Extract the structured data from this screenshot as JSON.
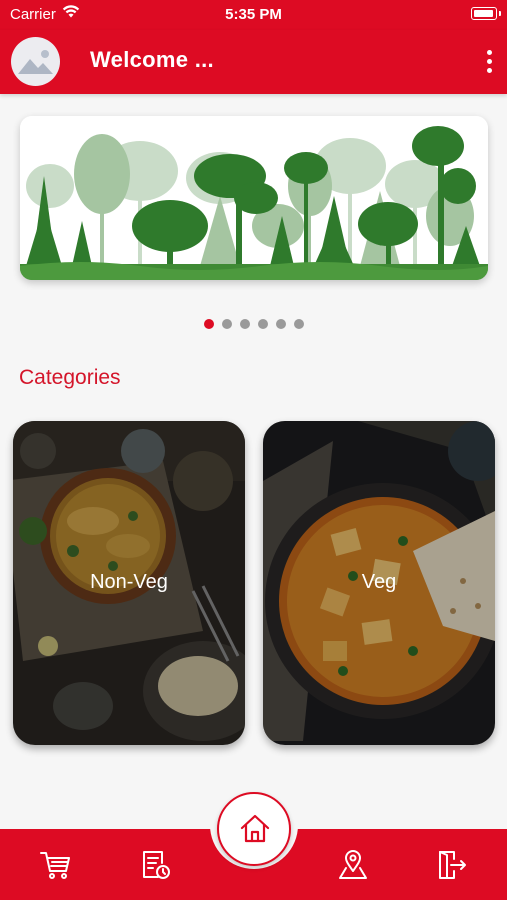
{
  "status_bar": {
    "carrier": "Carrier",
    "time": "5:35 PM"
  },
  "header": {
    "title": "Welcome ...",
    "avatar_icon": "image-placeholder-icon",
    "menu_icon": "more-vertical-icon"
  },
  "banner": {
    "image": "forest-trees-illustration",
    "slide_count": 6,
    "active_slide": 1
  },
  "categories": {
    "title": "Categories",
    "items": [
      {
        "label": "Non-Veg",
        "image": "chicken-curry-photo"
      },
      {
        "label": "Veg",
        "image": "paneer-curry-photo"
      }
    ]
  },
  "bottom_nav": {
    "items": [
      "cart-icon",
      "orders-icon",
      "home-icon",
      "location-icon",
      "logout-icon"
    ],
    "active": "home-icon"
  },
  "colors": {
    "brand": "#dd0b23",
    "background": "#f6f6f6",
    "dot_inactive": "#9a9a9a"
  }
}
